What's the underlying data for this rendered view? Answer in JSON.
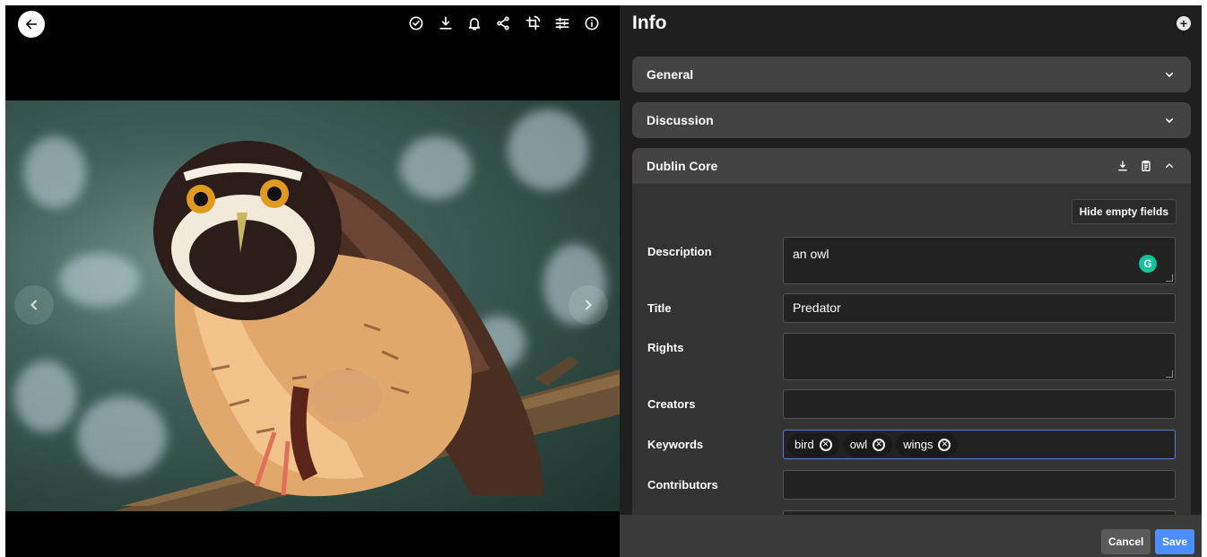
{
  "panel": {
    "title": "Info",
    "sections": {
      "general": "General",
      "discussion": "Discussion",
      "dublin_core": "Dublin Core"
    },
    "hide_empty_label": "Hide empty fields",
    "fields": {
      "description_label": "Description",
      "description_value": "an owl",
      "title_label": "Title",
      "title_value": "Predator",
      "rights_label": "Rights",
      "creators_label": "Creators",
      "keywords_label": "Keywords",
      "keywords": [
        "bird",
        "owl",
        "wings"
      ],
      "contributors_label": "Contributors"
    },
    "grammarly_letter": "G",
    "cancel_label": "Cancel",
    "save_label": "Save"
  },
  "colors": {
    "accent": "#4c8dff",
    "panel_bg": "#1f1f1f",
    "section_bg": "#434343",
    "grammarly": "#15c39a"
  },
  "icons": [
    "back-arrow-icon",
    "check-circle-icon",
    "download-icon",
    "bell-icon",
    "share-icon",
    "crop-rotate-icon",
    "sliders-icon",
    "info-icon",
    "chevron-left-icon",
    "chevron-right-icon",
    "plus-circle-icon",
    "chevron-down-icon",
    "chevron-up-icon",
    "clipboard-icon"
  ]
}
